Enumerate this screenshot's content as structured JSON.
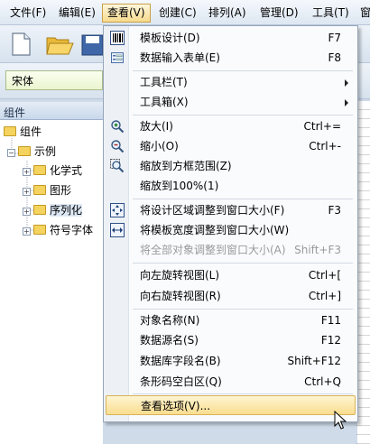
{
  "menubar": {
    "items": [
      "文件(F)",
      "编辑(E)",
      "查看(V)",
      "创建(C)",
      "排列(A)",
      "管理(D)",
      "工具(T)",
      "窗"
    ]
  },
  "fontbar": {
    "font": "宋体"
  },
  "panel": {
    "title": "组件",
    "tree": {
      "root": "组件",
      "group": "示例",
      "children": [
        "化学式",
        "图形",
        "序列化",
        "符号字体"
      ]
    }
  },
  "menu": {
    "items": [
      {
        "label": "模板设计(D)",
        "shortcut": "F7",
        "icon": "barcode-icon"
      },
      {
        "label": "数据输入表单(E)",
        "shortcut": "F8",
        "icon": "form-icon"
      },
      {
        "label": "工具栏(T)",
        "submenu": true
      },
      {
        "label": "工具箱(X)",
        "submenu": true
      },
      {
        "label": "放大(I)",
        "shortcut": "Ctrl+=",
        "icon": "zoom-in-icon"
      },
      {
        "label": "缩小(O)",
        "shortcut": "Ctrl+-",
        "icon": "zoom-out-icon"
      },
      {
        "label": "缩放到方框范围(Z)",
        "icon": "zoom-box-icon"
      },
      {
        "label": "缩放到100%(1)"
      },
      {
        "label": "将设计区域调整到窗口大小(F)",
        "shortcut": "F3",
        "icon": "fit-window-icon"
      },
      {
        "label": "将模板宽度调整到窗口大小(W)",
        "icon": "fit-width-icon"
      },
      {
        "label": "将全部对象调整到窗口大小(A)",
        "shortcut": "Shift+F3",
        "disabled": true
      },
      {
        "label": "向左旋转视图(L)",
        "shortcut": "Ctrl+["
      },
      {
        "label": "向右旋转视图(R)",
        "shortcut": "Ctrl+]"
      },
      {
        "label": "对象名称(N)",
        "shortcut": "F11"
      },
      {
        "label": "数据源名(S)",
        "shortcut": "F12"
      },
      {
        "label": "数据库字段名(B)",
        "shortcut": "Shift+F12"
      },
      {
        "label": "条形码空白区(Q)",
        "shortcut": "Ctrl+Q"
      },
      {
        "label": "查看选项(V)...",
        "highlighted": true
      }
    ]
  }
}
